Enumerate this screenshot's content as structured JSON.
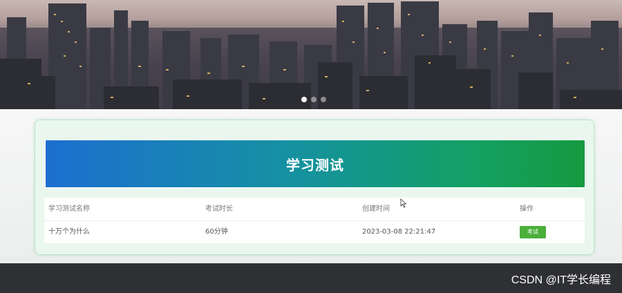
{
  "banner": {
    "slides": 3,
    "active_slide": 1
  },
  "card": {
    "title": "学习测试"
  },
  "table": {
    "headers": [
      "学习测试名称",
      "考试时长",
      "创建时间",
      "操作"
    ],
    "rows": [
      {
        "name": "十万个为什么",
        "duration": "60分钟",
        "created": "2023-03-08 22:21:47",
        "action": "考试"
      }
    ]
  },
  "watermark": {
    "text": "CSDN @IT学长编程"
  },
  "colors": {
    "title_gradient_start": "#1d6fd0",
    "title_gradient_end": "#159a40",
    "exam_button": "#4caf3c",
    "footer": "#2f3033"
  }
}
